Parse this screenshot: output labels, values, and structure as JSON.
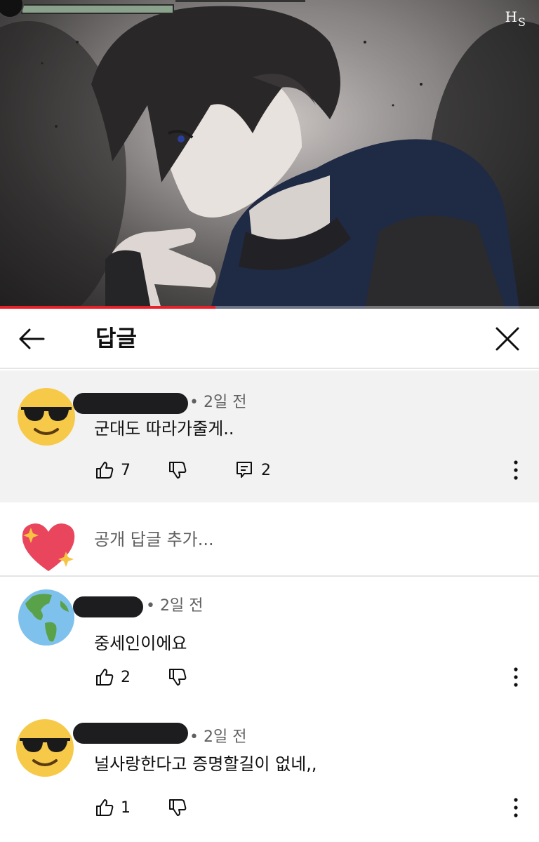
{
  "video": {
    "watermark_main": "H",
    "watermark_sub": "S",
    "progress_fraction": 0.4
  },
  "header": {
    "title": "답글"
  },
  "parent_comment": {
    "time": "2일 전",
    "text": "군대도 따라가줄게..",
    "likes": "7",
    "replies": "2",
    "avatar_icon": "sunglasses-emoji-icon"
  },
  "reply_input": {
    "placeholder": "공개 답글 추가...",
    "avatar_icon": "sparkling-heart-icon"
  },
  "replies": [
    {
      "time": "2일 전",
      "text": "중세인이에요",
      "likes": "2",
      "avatar_icon": "globe-americas-icon"
    },
    {
      "time": "2일 전",
      "text": "널사랑한다고 증명할길이 없네,,",
      "likes": "1",
      "avatar_icon": "sunglasses-emoji-icon"
    }
  ],
  "colors": {
    "accent_red": "#e8202a",
    "emoji_yellow": "#f7c948",
    "comment_highlight": "#f2f2f2"
  }
}
